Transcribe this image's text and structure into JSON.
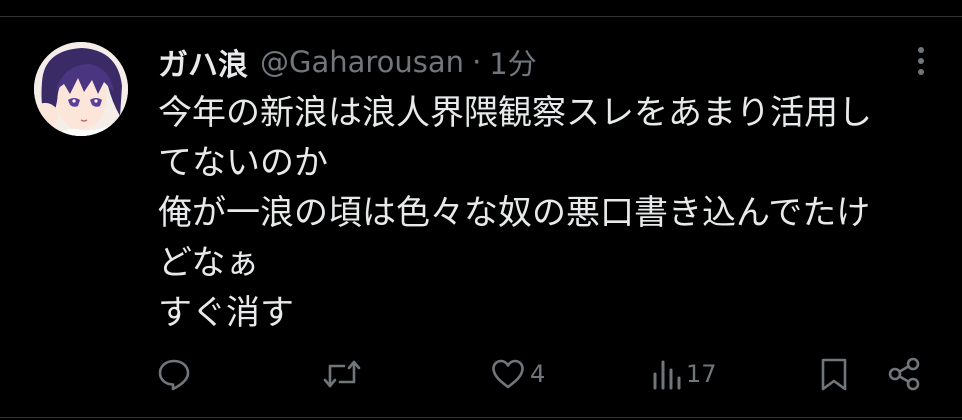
{
  "theme": {
    "background": "#000000",
    "text_primary": "#e7e9ea",
    "text_secondary": "#71767b",
    "divider": "#2f3336"
  },
  "tweet": {
    "author": {
      "display_name": "ガハ浪",
      "handle": "@Gaharousan",
      "separator": "·",
      "time": "1分",
      "avatar_icon": "anime-character-avatar"
    },
    "text_lines": [
      "今年の新浪は浪人界隈観察スレをあまり活用し",
      "てないのか",
      "俺が一浪の頃は色々な奴の悪口書き込んでたけ",
      "どなぁ",
      "すぐ消す"
    ],
    "more_icon": "vertical-dots-icon"
  },
  "actions": {
    "reply": {
      "icon": "reply-bubble-icon",
      "count": ""
    },
    "retweet": {
      "icon": "retweet-icon",
      "count": ""
    },
    "like": {
      "icon": "heart-icon",
      "count": "4"
    },
    "views": {
      "icon": "bar-chart-icon",
      "count": "17"
    },
    "bookmark": {
      "icon": "bookmark-icon"
    },
    "share": {
      "icon": "share-nodes-icon"
    }
  }
}
